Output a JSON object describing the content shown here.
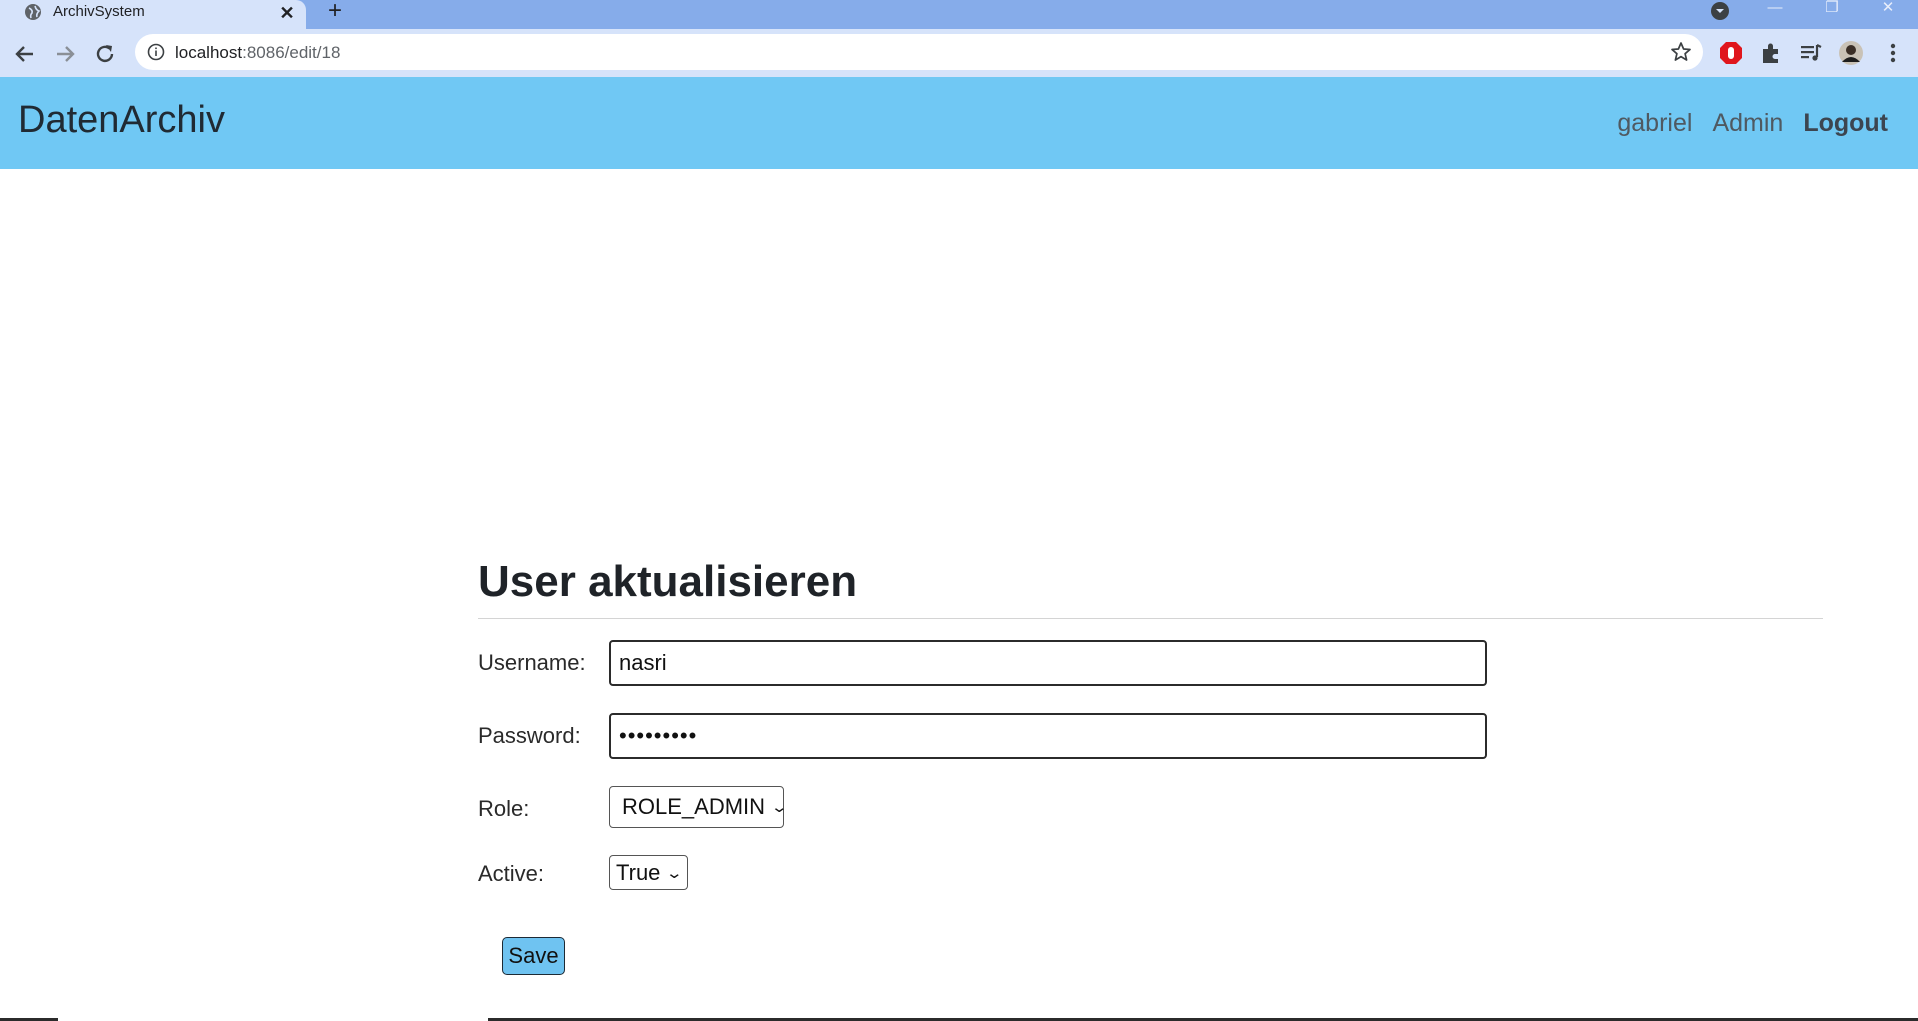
{
  "browser": {
    "tab_title": "ArchivSystem",
    "url_host": "localhost",
    "url_path": ":8086/edit/18"
  },
  "app": {
    "brand": "DatenArchiv",
    "nav": [
      "gabriel",
      "Admin",
      "Logout"
    ]
  },
  "form": {
    "title": "User aktualisieren",
    "username_label": "Username:",
    "username_value": "nasri",
    "password_label": "Password:",
    "password_value": "•••••••••",
    "role_label": "Role:",
    "role_selected": "ROLE_ADMIN",
    "active_label": "Active:",
    "active_selected": "True",
    "save_label": "Save"
  },
  "colors": {
    "tabstrip": "#86acea",
    "toolbar": "#d6e3fa",
    "header": "#70c8f4",
    "save_button": "#6fc3f1"
  }
}
